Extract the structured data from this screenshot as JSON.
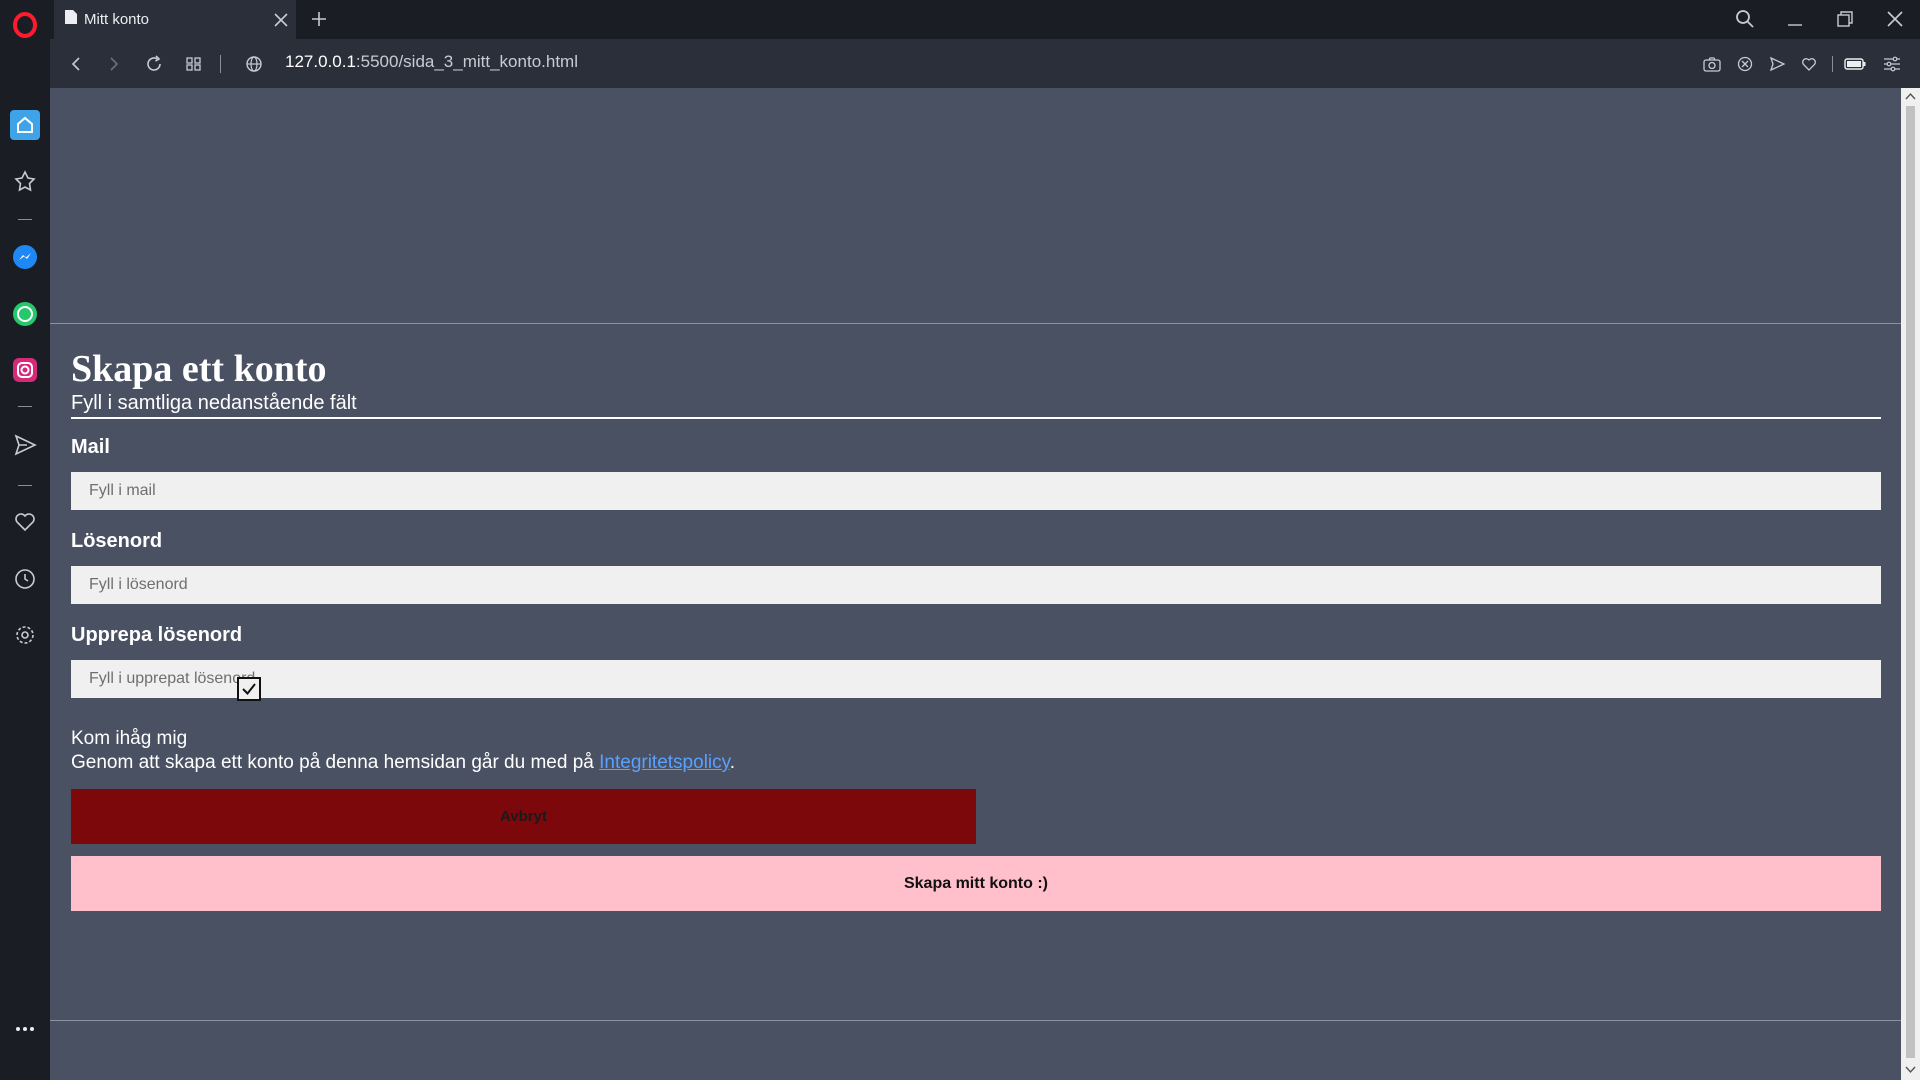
{
  "browser": {
    "tab_title": "Mitt konto",
    "url_host": "127.0.0.1",
    "url_rest": ":5500/sida_3_mitt_konto.html",
    "sidebar_icons": [
      "opera-logo-icon",
      "home-icon",
      "bookmarks-icon",
      "messenger-icon",
      "whatsapp-icon",
      "instagram-icon",
      "send-icon",
      "heart-icon",
      "history-icon",
      "settings-icon",
      "more-icon"
    ],
    "colors": {
      "chrome_dark": "#1b1d24",
      "chrome_bar": "#2b2f39",
      "opera_red": "#ff1b2d"
    }
  },
  "page": {
    "heading": "Skapa ett konto",
    "subheading": "Fyll i samtliga nedanstående fält",
    "mail": {
      "label": "Mail",
      "placeholder": "Fyll i mail"
    },
    "password": {
      "label": "Lösenord",
      "placeholder": "Fyll i lösenord"
    },
    "repeat_password": {
      "label": "Upprepa lösenord",
      "placeholder": "Fyll i upprepat lösenord"
    },
    "remember_me": {
      "label": "Kom ihåg mig",
      "checked": true
    },
    "policy": {
      "prefix": "Genom att skapa ett konto på denna hemsidan går du med på ",
      "link": "Integritetspolicy",
      "suffix": "."
    },
    "cancel_button": "Avbryt",
    "create_button": "Skapa mitt konto :)",
    "colors": {
      "background": "#4a5163",
      "cancel": "#7d080b",
      "create": "#ffbfcb",
      "link": "#5aa0ff"
    }
  }
}
